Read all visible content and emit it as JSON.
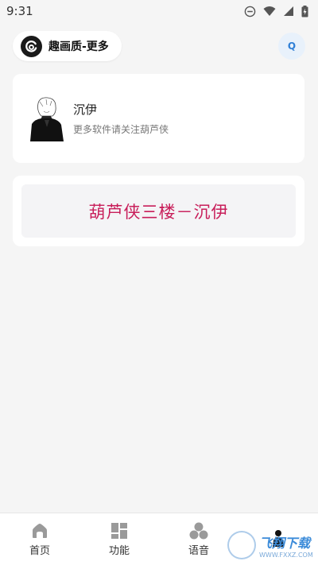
{
  "status_bar": {
    "time": "9:31",
    "icons": [
      "do-not-disturb-icon",
      "wifi-icon",
      "signal-icon",
      "battery-charging-icon"
    ]
  },
  "header": {
    "app_title": "趣画质-更多",
    "logo_icon": "app-logo-icon",
    "q_button": "Q"
  },
  "profile": {
    "name": "沉伊",
    "subtitle": "更多软件请关注葫芦侠"
  },
  "banner": {
    "text": "葫芦侠三楼－沉伊"
  },
  "bottom_nav": {
    "items": [
      {
        "label": "首页",
        "icon": "home-icon"
      },
      {
        "label": "功能",
        "icon": "grid-icon"
      },
      {
        "label": "语音",
        "icon": "voice-icon"
      },
      {
        "label": "",
        "icon": "profile-icon"
      }
    ]
  },
  "watermark": {
    "main": "飞翔下载",
    "sub": "WWW.FXXZ.COM"
  },
  "colors": {
    "background": "#f5f5f5",
    "card": "#ffffff",
    "banner_text": "#c81e5a",
    "q_button": "#2f7fd6",
    "q_button_bg": "#e8f1fb"
  }
}
